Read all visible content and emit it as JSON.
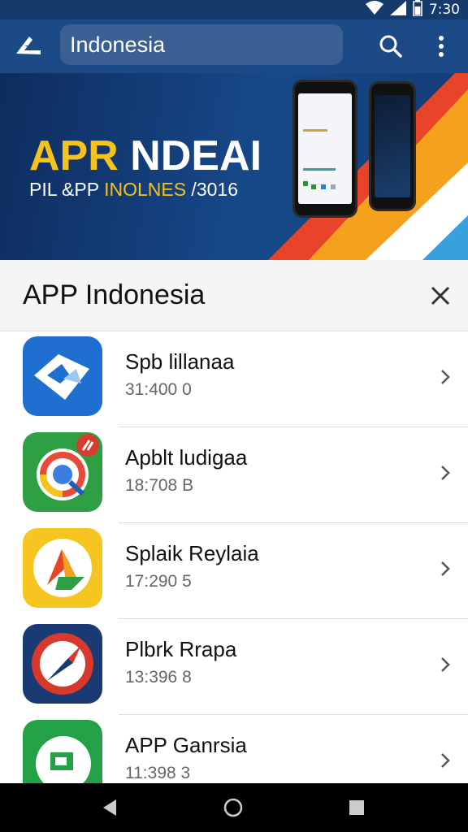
{
  "status_bar": {
    "time": "7:30"
  },
  "app_bar": {
    "search_value": "Indonesia",
    "icons": {
      "back": "app-logo-back-icon",
      "search": "search-icon",
      "more": "more-vert-icon"
    }
  },
  "banner": {
    "title_part1": "APR",
    "title_part2": " NDEAI",
    "subtitle_part1": "PIL &PP ",
    "subtitle_part2": "INOLNES",
    "subtitle_part3": " /3016"
  },
  "sheet": {
    "title": "APP Indonesia",
    "close_icon": "close-icon"
  },
  "apps": [
    {
      "name": "Spb lillanaa",
      "meta": "31:400 0",
      "icon": "blue-envelope-app-icon"
    },
    {
      "name": "Apblt ludigaa",
      "meta": "18:708 B",
      "icon": "browser-app-icon"
    },
    {
      "name": "Splaik Reylaia",
      "meta": "17:290 5",
      "icon": "yellow-arrow-app-icon"
    },
    {
      "name": "Plbrk Rrapa",
      "meta": "13:396 8",
      "icon": "compass-app-icon"
    },
    {
      "name": "APP Ganrsia",
      "meta": "11:398 3",
      "icon": "green-chat-app-icon"
    }
  ],
  "colors": {
    "app_bar": "#1b4a86",
    "banner_accent": "#f6c21c",
    "nav_bar": "#000000"
  }
}
